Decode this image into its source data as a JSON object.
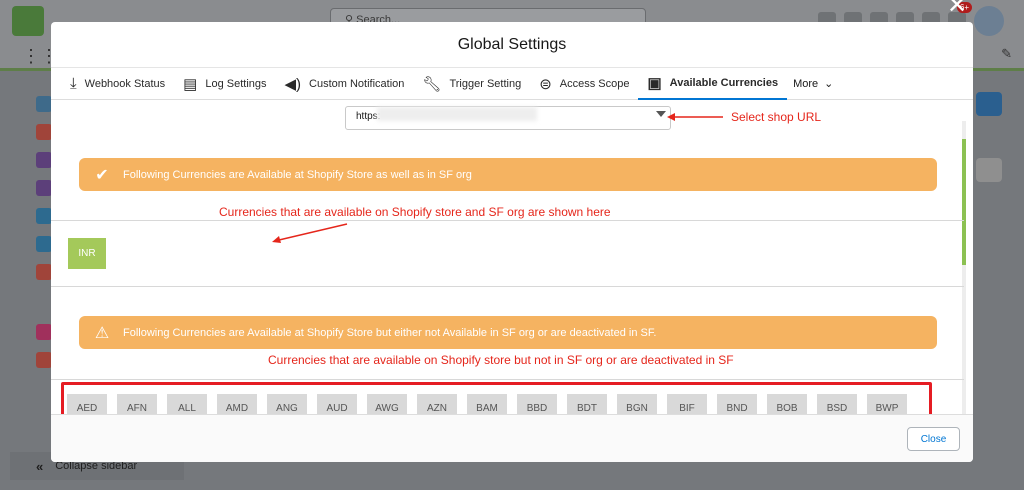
{
  "background": {
    "search_placeholder": "Search...",
    "notification_count": "6+",
    "collapse_label": "Collapse sidebar"
  },
  "modal": {
    "title": "Global Settings",
    "tabs": [
      {
        "label": "Webhook Status",
        "icon": "download-tray-icon"
      },
      {
        "label": "Log Settings",
        "icon": "log-icon"
      },
      {
        "label": "Custom Notification",
        "icon": "megaphone-icon"
      },
      {
        "label": "Trigger Setting",
        "icon": "wrench-icon"
      },
      {
        "label": "Access Scope",
        "icon": "toggle-icon"
      },
      {
        "label": "Available Currencies",
        "icon": "money-icon",
        "active": true
      }
    ],
    "more_label": "More",
    "shop_url_prefix": "https:",
    "annotation_select": "Select shop URL",
    "banner_available": "Following Currencies are Available at Shopify Store as well as in SF org",
    "annotation_available": "Currencies that are available on Shopify store and SF org are shown here",
    "available_currencies": [
      "INR"
    ],
    "banner_unavailable": "Following Currencies are Available at Shopify Store but either not Available in SF org or are deactivated in SF.",
    "annotation_unavailable": "Currencies that are available on Shopify store but not in SF org or are deactivated in SF",
    "unavailable_currencies": [
      "AED",
      "AFN",
      "ALL",
      "AMD",
      "ANG",
      "AUD",
      "AWG",
      "AZN",
      "BAM",
      "BBD",
      "BDT",
      "BGN",
      "BIF",
      "BND",
      "BOB",
      "BSD",
      "BWP"
    ],
    "close_label": "Close"
  },
  "colors": {
    "banner": "#f5b361",
    "available_chip": "#a4c95a",
    "annotation": "#e5261b",
    "active_tab": "#0176d3"
  }
}
